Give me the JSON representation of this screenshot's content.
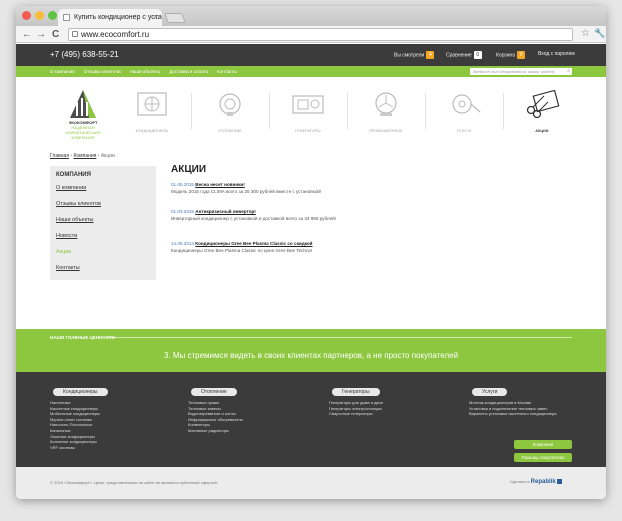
{
  "browser": {
    "tab_title": "Купить кондиционер с уста",
    "tab_close": "×",
    "url": "www.ecocomfort.ru",
    "back": "←",
    "forward": "→",
    "reload": "C"
  },
  "topbar": {
    "phone": "+7 (495) 638-55-21",
    "viewed_label": "Вы смотрели",
    "viewed_count": "4",
    "compare_label": "Сравнение",
    "compare_count": "0",
    "cart_label": "Корзина",
    "cart_count": "0",
    "login_label": "Вход с паролем"
  },
  "mainnav": {
    "items": [
      "О компании",
      "Отзывы клиентов",
      "Наши объекты",
      "Доставка и оплата",
      "Контакты"
    ],
    "search_placeholder": "Введите тип оборудования, марку, модель"
  },
  "logo": {
    "name": "ЭКОКОМФОРТ",
    "tagline": "НАДЕЖНАЯ КЛИМАТИЧЕСКАЯ КОМПАНИЯ"
  },
  "categories": [
    {
      "label": "КОНДИЦИОНЕРЫ",
      "icon": "air-conditioner-icon"
    },
    {
      "label": "ОТОПЛЕНИЕ",
      "icon": "heater-icon"
    },
    {
      "label": "ГЕНЕРАТОРЫ",
      "icon": "generator-icon"
    },
    {
      "label": "ПРОМЫШЛЕННОЕ",
      "icon": "industrial-fan-icon"
    },
    {
      "label": "УСЛУГИ",
      "icon": "tape-measure-icon"
    },
    {
      "label": "АКЦИИ",
      "icon": "scissors-icon"
    }
  ],
  "breadcrumbs": {
    "home": "Главная",
    "company": "Компания",
    "current": "Акции",
    "sep": "›"
  },
  "sidebar": {
    "title": "КОМПАНИЯ",
    "items": [
      "О компании",
      "Отзывы клиентов",
      "Наши объекты",
      "Новости",
      "Акции",
      "Контакты"
    ]
  },
  "content": {
    "title": "АКЦИИ",
    "news": [
      {
        "date": "01.05.2015",
        "title": "Весна несет новинки!",
        "text": "Модель 2015 года CLIMA всего за 25 300 рублей вместе с установкой!"
      },
      {
        "date": "01.03.2015",
        "title": "Антикризисный инвертор!",
        "text": "Инверторный кондиционер с установкой и доставкой всего за 34 990 рублей!"
      },
      {
        "date": "14.05.2014",
        "title": "Кондиционеры Gree Bee Plasma Classic со скидкой",
        "text": "Кондиционеры Gree  Bee Plasma Classic по цене Gree  Bee Techno!"
      }
    ]
  },
  "values": {
    "title": "НАШИ ГЛАВНЫЕ ЦЕННОСТИ",
    "text": "3. Мы стремимся видеть в своих клиентах партнеров, а не просто покупателей"
  },
  "footer": {
    "columns": [
      {
        "title": "Кондиционеры",
        "links": [
          "Настенные",
          "Кассетные кондиционеры",
          "Мобильные кондиционеры",
          "Мульти сплит системы",
          "Напольно-Потолочные",
          "Канальные",
          "Оконные кондиционеры",
          "Колонные кондиционеры",
          "VRF системы"
        ]
      },
      {
        "title": "Отопление",
        "links": [
          "Тепловые пушки",
          "Тепловые завесы",
          "Водонагреватели и котлы",
          "Инфракрасные обогреватели",
          "Конвекторы",
          "Масляные радиаторы"
        ]
      },
      {
        "title": "Генераторы",
        "links": [
          "Генераторы для дома и дачи",
          "Генераторы электростанции",
          "Сварочные генераторы"
        ]
      },
      {
        "title": "Услуги",
        "links": [
          "Монтаж кондиционеров в Москве",
          "Установка и подключение тепловых завес",
          "Варианты установки настенного кондиционера"
        ]
      }
    ],
    "btn_company": "Компания",
    "btn_help": "Помощь покупателю"
  },
  "bottom": {
    "copyright": "© 2016 «Экокомфорт». Цены, представленные на сайте не являются публичной офертой.",
    "made_by": "Сделано в",
    "studio": "Repablik"
  },
  "colors": {
    "brand_green": "#8dc63f",
    "dark": "#3b3b3b",
    "badge_orange": "#f5a623",
    "link_blue": "#4a78b8"
  }
}
